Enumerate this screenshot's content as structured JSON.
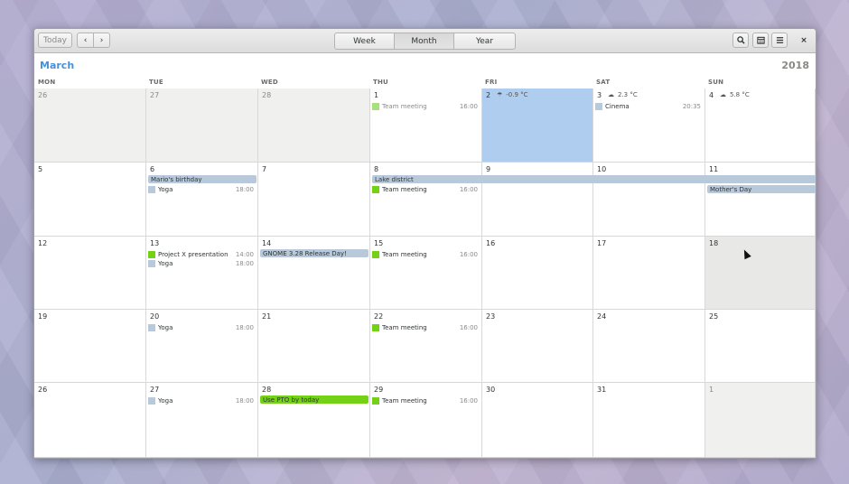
{
  "toolbar": {
    "today_label": "Today",
    "prev_icon": "‹",
    "next_icon": "›",
    "views": [
      "Week",
      "Month",
      "Year"
    ],
    "active_view": "Month",
    "search_icon": "search-icon",
    "calendars_icon": "calendar-icon",
    "menu_icon": "menu-icon",
    "close_icon": "×"
  },
  "header": {
    "month": "March",
    "year": "2018"
  },
  "weekdays": [
    "MON",
    "TUE",
    "WED",
    "THU",
    "FRI",
    "SAT",
    "SUN"
  ],
  "colors": {
    "accent": "#4a90d9",
    "today_bg": "#afcdee",
    "event_green": "#73d216",
    "event_blue": "#b8c9dc"
  },
  "weeks": [
    {
      "days": [
        {
          "num": "26",
          "other": true
        },
        {
          "num": "27",
          "other": true
        },
        {
          "num": "28",
          "other": true
        },
        {
          "num": "1",
          "events": [
            {
              "title": "Team meeting",
              "time": "16:00",
              "color": "#a8e07a",
              "faded": true
            }
          ]
        },
        {
          "num": "2",
          "today": true,
          "weather": {
            "icon": "☂",
            "temp": "-0.9 °C"
          }
        },
        {
          "num": "3",
          "weather": {
            "icon": "☁",
            "temp": "2.3 °C"
          },
          "events": [
            {
              "title": "Cinema",
              "time": "20:35",
              "color": "#b8c9dc"
            }
          ]
        },
        {
          "num": "4",
          "weather": {
            "icon": "☁",
            "temp": "5.8 °C"
          }
        }
      ]
    },
    {
      "days": [
        {
          "num": "5"
        },
        {
          "num": "6",
          "bars": [
            {
              "title": "Mario's birthday",
              "span": 1
            }
          ],
          "events": [
            {
              "title": "Yoga",
              "time": "18:00",
              "color": "#b8c9dc"
            }
          ]
        },
        {
          "num": "7"
        },
        {
          "num": "8",
          "bars": [
            {
              "title": "Lake district",
              "span": 4
            }
          ],
          "events": [
            {
              "title": "Team meeting",
              "time": "16:00",
              "color": "#73d216"
            }
          ]
        },
        {
          "num": "9"
        },
        {
          "num": "10"
        },
        {
          "num": "11",
          "bars2": [
            {
              "title": "Mother's Day"
            }
          ]
        }
      ]
    },
    {
      "days": [
        {
          "num": "12"
        },
        {
          "num": "13",
          "events": [
            {
              "title": "Project X presentation",
              "time": "14:00",
              "color": "#73d216"
            },
            {
              "title": "Yoga",
              "time": "18:00",
              "color": "#b8c9dc"
            }
          ]
        },
        {
          "num": "14",
          "bars": [
            {
              "title": "GNOME 3.28 Release Day!",
              "span": 1
            }
          ]
        },
        {
          "num": "15",
          "events": [
            {
              "title": "Team meeting",
              "time": "16:00",
              "color": "#73d216"
            }
          ]
        },
        {
          "num": "16"
        },
        {
          "num": "17"
        },
        {
          "num": "18",
          "hl": true
        }
      ]
    },
    {
      "days": [
        {
          "num": "19"
        },
        {
          "num": "20",
          "events": [
            {
              "title": "Yoga",
              "time": "18:00",
              "color": "#b8c9dc"
            }
          ]
        },
        {
          "num": "21"
        },
        {
          "num": "22",
          "events": [
            {
              "title": "Team meeting",
              "time": "16:00",
              "color": "#73d216"
            }
          ]
        },
        {
          "num": "23"
        },
        {
          "num": "24"
        },
        {
          "num": "25"
        }
      ]
    },
    {
      "days": [
        {
          "num": "26"
        },
        {
          "num": "27",
          "events": [
            {
              "title": "Yoga",
              "time": "18:00",
              "color": "#b8c9dc"
            }
          ]
        },
        {
          "num": "28",
          "bars": [
            {
              "title": "Use PTO by today",
              "span": 1,
              "green": true
            }
          ]
        },
        {
          "num": "29",
          "events": [
            {
              "title": "Team meeting",
              "time": "16:00",
              "color": "#73d216"
            }
          ]
        },
        {
          "num": "30"
        },
        {
          "num": "31"
        },
        {
          "num": "1",
          "other": true
        }
      ]
    }
  ]
}
